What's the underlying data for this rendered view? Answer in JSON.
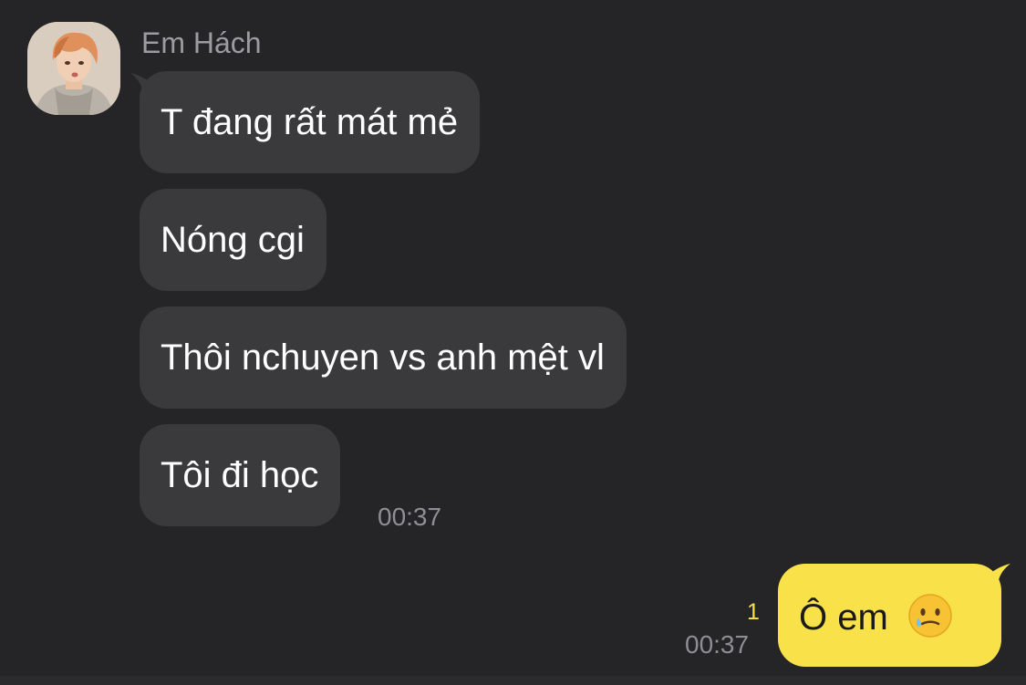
{
  "sender": {
    "name": "Em Hách",
    "avatar_icon": "profile-photo"
  },
  "messages_received": [
    {
      "text": "T đang rất mát mẻ"
    },
    {
      "text": "Nóng cgi"
    },
    {
      "text": "Thôi nchuyen vs anh mệt vl"
    },
    {
      "text": "Tôi đi học"
    }
  ],
  "received_time": "00:37",
  "message_sent": {
    "text": "Ô em",
    "emoji_icon": "smiling-face-with-tear-emoji",
    "unread_count": "1",
    "time": "00:37"
  },
  "colors": {
    "background": "#252527",
    "received_bubble": "#3a3a3c",
    "sent_bubble": "#f9e14a",
    "unread_count": "#f9e14a",
    "muted_text": "#8e8e93"
  }
}
